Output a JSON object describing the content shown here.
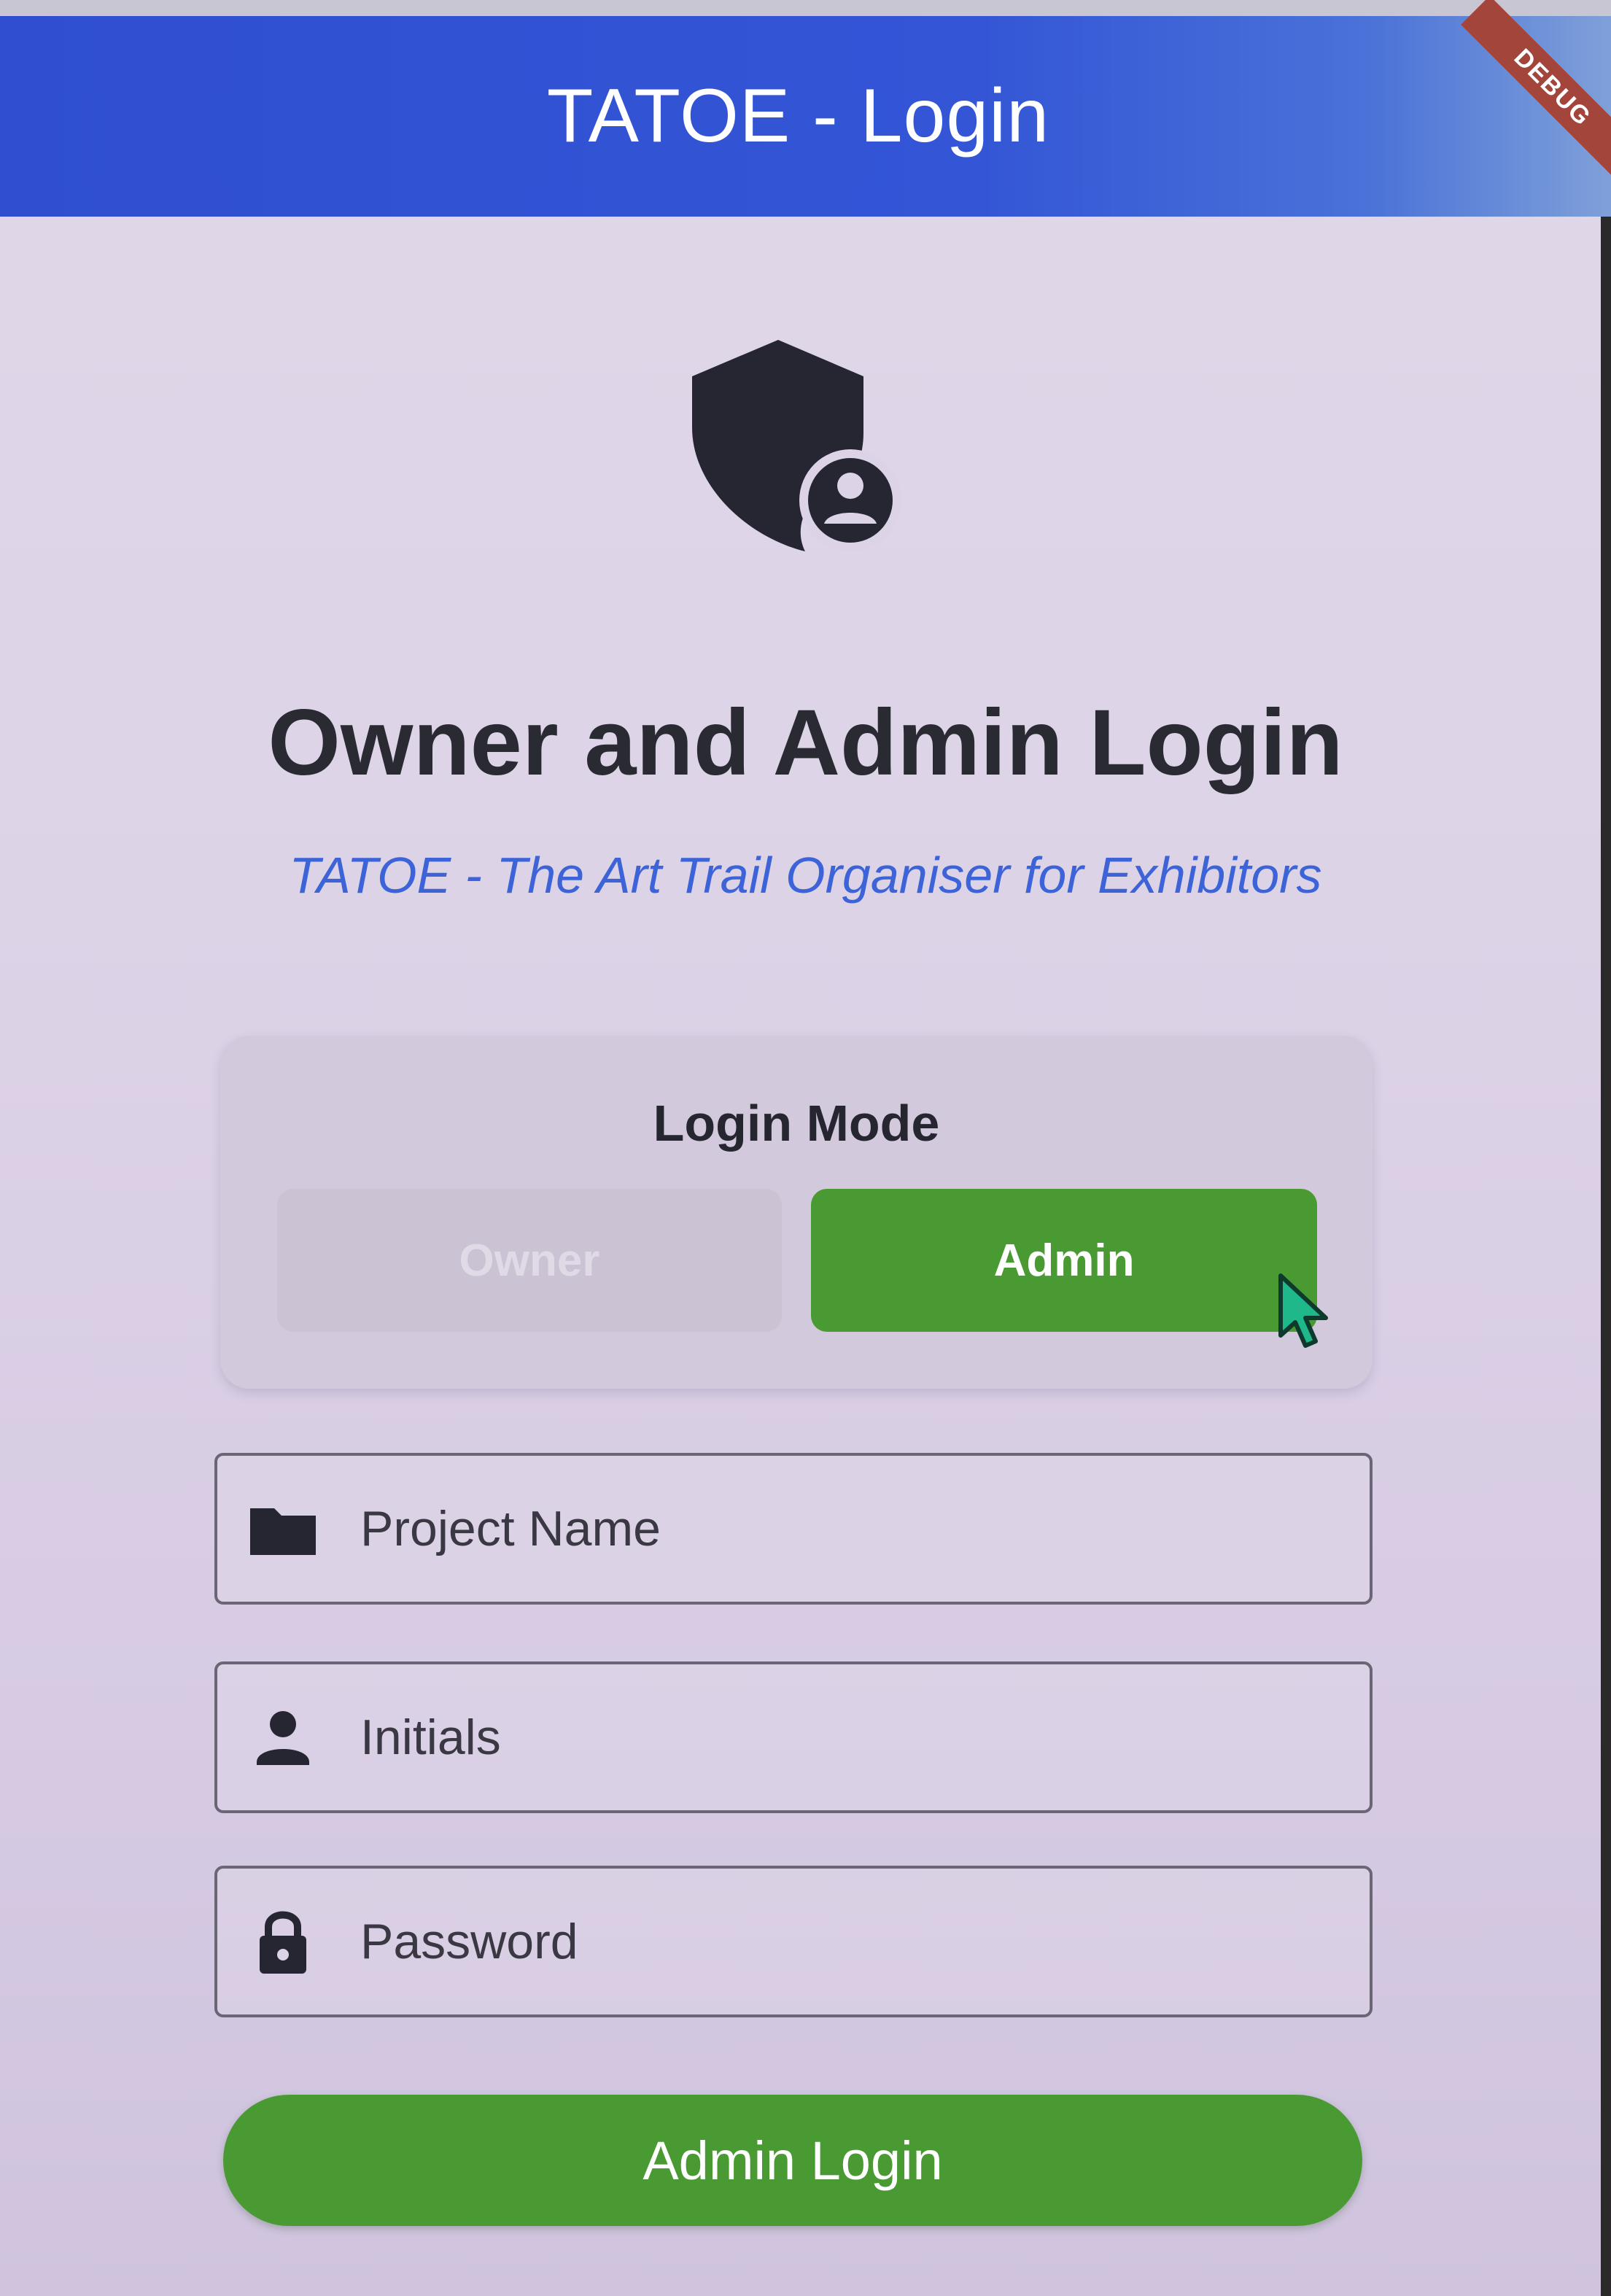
{
  "app_bar": {
    "title": "TATOE - Login",
    "debug_banner": "DEBUG",
    "color": "#3355d6"
  },
  "header": {
    "icon": "admin-shield-icon",
    "heading": "Owner and Admin Login",
    "subtitle": "TATOE - The Art Trail Organiser for Exhibitors",
    "subtitle_color": "#3c63d8"
  },
  "login_mode": {
    "label": "Login Mode",
    "options": [
      {
        "label": "Owner",
        "selected": false
      },
      {
        "label": "Admin",
        "selected": true
      }
    ],
    "active_color": "#4a9a33"
  },
  "form": {
    "project_name": {
      "placeholder": "Project Name",
      "value": "",
      "icon": "folder-icon"
    },
    "initials": {
      "placeholder": "Initials",
      "value": "",
      "icon": "person-icon"
    },
    "password": {
      "placeholder": "Password",
      "value": "",
      "icon": "lock-icon"
    }
  },
  "submit": {
    "label": "Admin Login",
    "color": "#4a9a33"
  }
}
